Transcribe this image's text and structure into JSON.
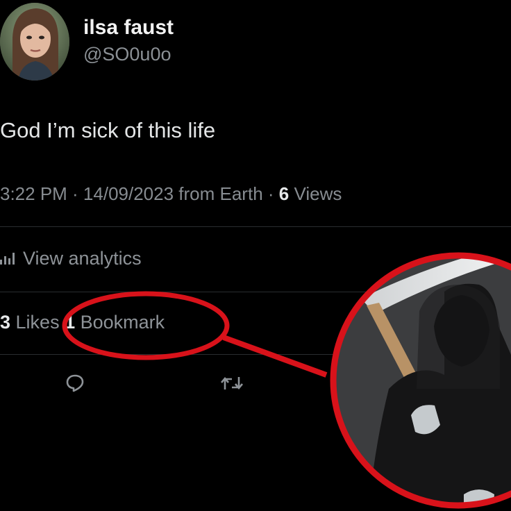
{
  "user": {
    "name": "ilsa faust",
    "handle": "@SO0u0o"
  },
  "tweet": {
    "text": "God I’m sick of this life"
  },
  "meta": {
    "time_date": "3:22 PM · 14/09/2023 from Earth · ",
    "views_count": "6",
    "views_label": " Views"
  },
  "analytics": {
    "label": "View analytics",
    "icon": "bar-chart-icon"
  },
  "stats": {
    "likes_count": "3",
    "likes_label": " Likes ",
    "bookmarks_count": "1",
    "bookmarks_label": " Bookmark"
  },
  "actions": {
    "reply_icon": "reply-icon",
    "retweet_icon": "retweet-icon"
  },
  "annotation": {
    "highlight_color": "#d8121a",
    "subject": "grim-reaper-image"
  }
}
